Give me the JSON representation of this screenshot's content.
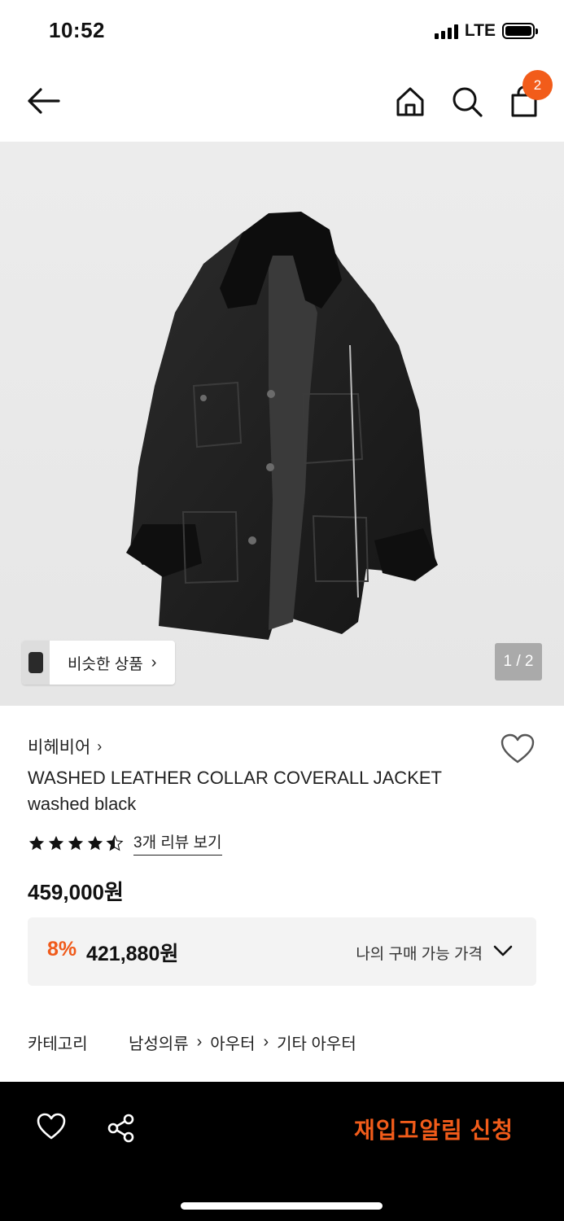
{
  "status_bar": {
    "time": "10:52",
    "network": "LTE"
  },
  "nav": {
    "back_icon": "arrow-left-icon",
    "home_icon": "home-icon",
    "search_icon": "search-icon",
    "bag_icon": "shopping-bag-icon",
    "bag_count": "2",
    "badge_color": "#f25c1a"
  },
  "hero": {
    "similar_label": "비슷한 상품",
    "similar_chevron": "›",
    "image_counter": "1 / 2"
  },
  "product": {
    "brand": "비헤비어",
    "brand_chevron": "›",
    "title": "WASHED LEATHER COLLAR COVERALL JACKET washed black",
    "rating_stars": 4.5,
    "review_link": "3개 리뷰 보기",
    "price": "459,000원",
    "discount_rate": "8%",
    "sale_price": "421,880원",
    "my_price_label": "나의 구매 가능 가격",
    "accent_color": "#f05a1a"
  },
  "category": {
    "label": "카테고리",
    "path": [
      "남성의류",
      "아우터",
      "기타 아우터"
    ]
  },
  "bottom_bar": {
    "heart_icon": "heart-outline-icon",
    "share_icon": "share-icon",
    "restock_button": "재입고알림 신청",
    "button_color": "#f25c1a"
  }
}
